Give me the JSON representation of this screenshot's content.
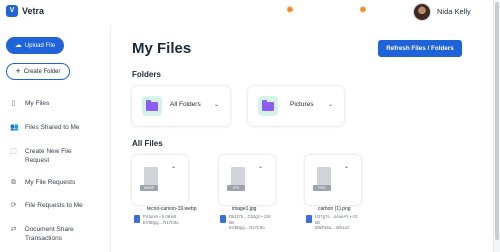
{
  "app": {
    "logo_letter": "V",
    "name": "Vetra"
  },
  "header": {
    "user_name": "Nida Kelly"
  },
  "sidebar": {
    "upload_label": "Upload File",
    "create_folder_label": "Create Folder",
    "items": [
      {
        "label": "My Files",
        "icon": "page-icon"
      },
      {
        "label": "Files Shared to Me",
        "icon": "users-icon"
      },
      {
        "label": "Create New File Request",
        "icon": "file-request-icon"
      },
      {
        "label": "My File Requests",
        "icon": "request-list-icon"
      },
      {
        "label": "File Requests to Me",
        "icon": "sync-icon"
      },
      {
        "label": "Document Share Transactions",
        "icon": "transfer-icon"
      }
    ]
  },
  "main": {
    "title": "My Files",
    "refresh_label": "Refresh Files / Folders",
    "folders_title": "Folders",
    "folders": [
      {
        "name": "All Folders"
      },
      {
        "name": "Pictures"
      }
    ],
    "files_title": "All Files",
    "files": [
      {
        "badge": "WEBP",
        "name": "tecno-camon-19.webp",
        "meta1": "Pictures • 5.06 kB",
        "meta2": "EV9Dpg....R17C8o"
      },
      {
        "badge": "JPG",
        "name": "image1.jpg",
        "meta1": "Dk2z7k....Cb3g2 • 126",
        "meta2": "kB",
        "meta3": "EV9Dpg....R17C8o"
      },
      {
        "badge": "PNG",
        "name": "carbon (1).png",
        "meta1": "U27g7s....e4ueAY • 43",
        "meta2": "kB",
        "meta3": "BWFs5a....Wh1Jd"
      }
    ]
  },
  "colors": {
    "primary": "#1e63d8",
    "folder": "#8b5cf6",
    "folder_bg": "#d6f3ea",
    "sun": "#f08a24"
  }
}
